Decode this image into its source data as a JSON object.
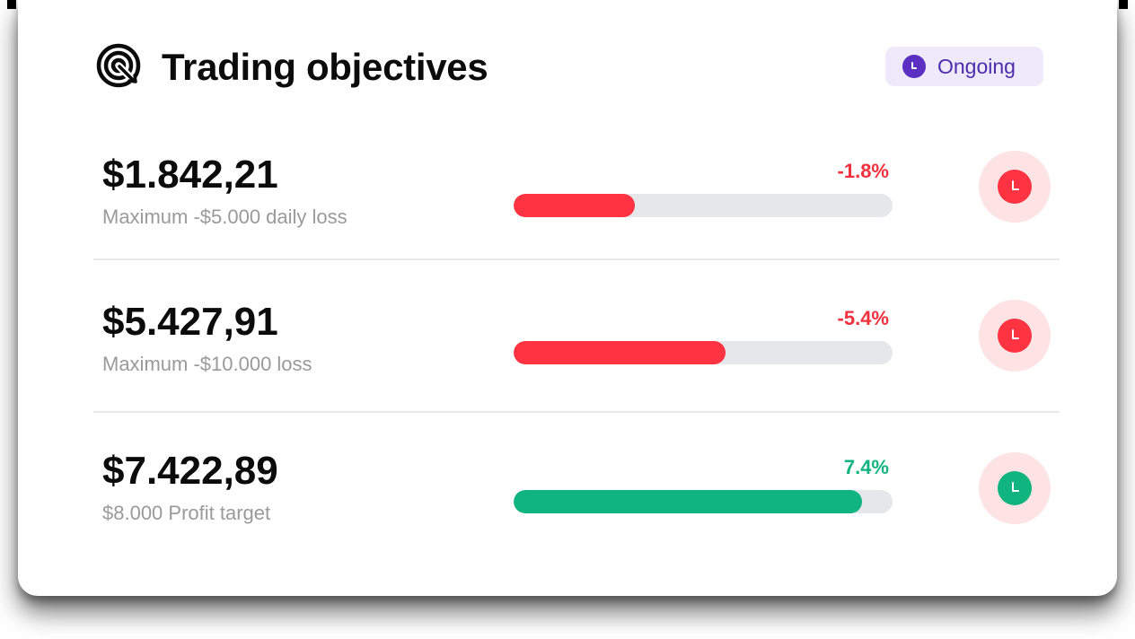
{
  "header": {
    "title": "Trading objectives",
    "icon": "target-icon",
    "status": {
      "label": "Ongoing",
      "icon": "clock-icon",
      "color": "#5a2fc2",
      "bg": "#eeeafc"
    }
  },
  "objectives": [
    {
      "amount": "$1.842,21",
      "description": "Maximum -$5.000 daily loss",
      "percent": "-1.8%",
      "progress_percent": 32,
      "color": "#ff3341",
      "state_icon": "clock-icon"
    },
    {
      "amount": "$5.427,91",
      "description": "Maximum -$10.000 loss",
      "percent": "-5.4%",
      "progress_percent": 56,
      "color": "#ff3341",
      "state_icon": "clock-icon"
    },
    {
      "amount": "$7.422,89",
      "description": "$8.000 Profit target",
      "percent": "7.4%",
      "progress_percent": 92,
      "color": "#10b47e",
      "state_icon": "clock-icon"
    }
  ]
}
